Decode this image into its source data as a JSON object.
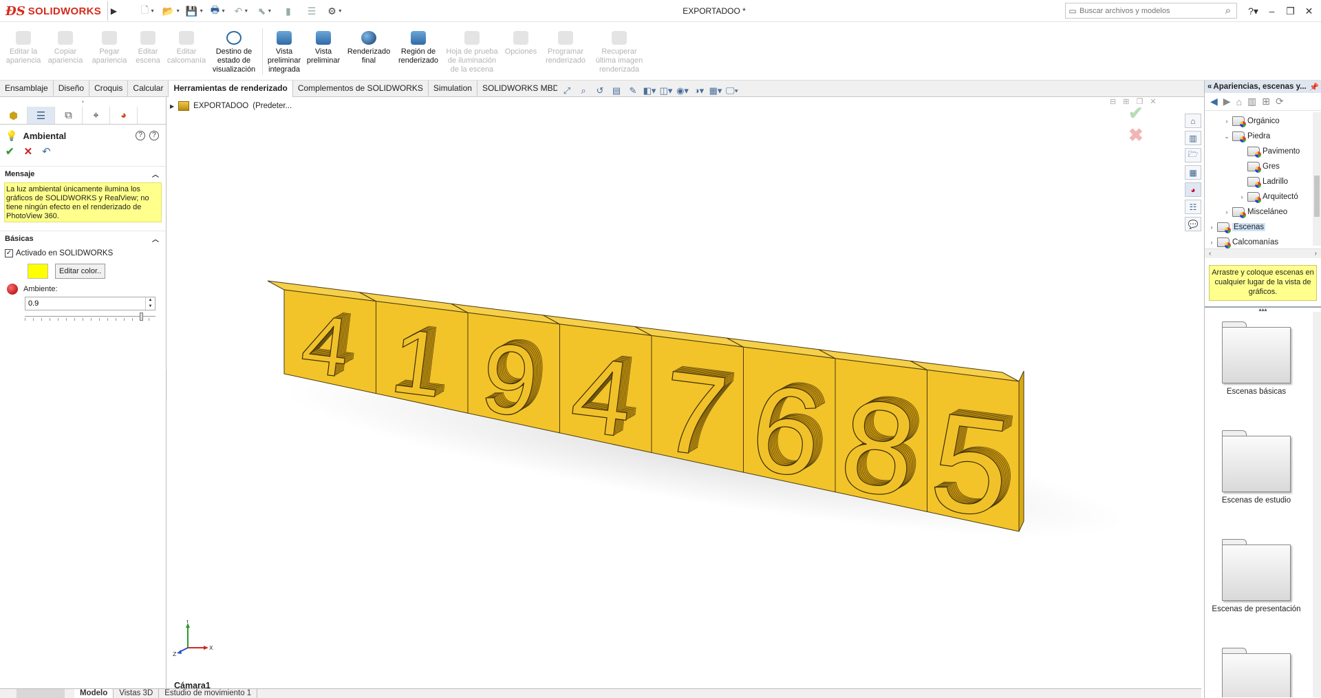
{
  "app": {
    "brand": "SOLIDWORKS",
    "document_title": "EXPORTADOO *"
  },
  "search": {
    "placeholder": "Buscar archivos y modelos"
  },
  "ribbon": {
    "buttons": [
      {
        "label": "Editar la apariencia",
        "enabled": false
      },
      {
        "label": "Copiar apariencia",
        "enabled": false
      },
      {
        "label": "Pegar apariencia",
        "enabled": false
      },
      {
        "label": "Editar escena",
        "enabled": false
      },
      {
        "label": "Editar calcomanía",
        "enabled": false
      },
      {
        "label": "Destino de estado de visualización",
        "enabled": true
      },
      {
        "label": "Vista preliminar integrada",
        "enabled": true
      },
      {
        "label": "Vista preliminar",
        "enabled": true
      },
      {
        "label": "Renderizado final",
        "enabled": true
      },
      {
        "label": "Región de renderizado",
        "enabled": true
      },
      {
        "label": "Hoja de prueba de iluminación de la escena",
        "enabled": false
      },
      {
        "label": "Opciones",
        "enabled": false
      },
      {
        "label": "Programar renderizado",
        "enabled": false
      },
      {
        "label": "Recuperar última imagen renderizada",
        "enabled": false
      }
    ]
  },
  "command_tabs": [
    "Ensamblaje",
    "Diseño",
    "Croquis",
    "Calcular",
    "Herramientas de renderizado",
    "Complementos de SOLIDWORKS",
    "Simulation",
    "SOLIDWORKS MBD"
  ],
  "command_tabs_active": "Herramientas de renderizado",
  "property_manager": {
    "title": "Ambiental",
    "message_section": "Mensaje",
    "message": "La luz ambiental únicamente ilumina los gráficos de SOLIDWORKS y RealView; no tiene ningún efecto en el renderizado de PhotoView 360.",
    "basic_section": "Básicas",
    "enabled_label": "Activado en SOLIDWORKS",
    "enabled_checked": true,
    "edit_color_label": "Editar color..",
    "ambient_color": "#ffff00",
    "ambient_label": "Ambiente:",
    "ambient_value": "0.9",
    "ambient_fraction": 0.9
  },
  "feature_tree": {
    "root_label": "EXPORTADOO",
    "root_config": "(Predeter..."
  },
  "model": {
    "digits": [
      "4",
      "1",
      "9",
      "4",
      "7",
      "6",
      "8",
      "5"
    ],
    "color": "#f2c42a"
  },
  "viewport": {
    "camera_label": "Cámara1"
  },
  "bottom_tabs": [
    "Modelo",
    "Vistas 3D",
    "Estudio de movimiento 1"
  ],
  "bottom_tabs_active": "Modelo",
  "task_pane": {
    "header": "Apariencias, escenas y...",
    "tree": [
      {
        "label": "Orgánico",
        "level": 1,
        "expanded": false
      },
      {
        "label": "Piedra",
        "level": 1,
        "expanded": true
      },
      {
        "label": "Pavimento",
        "level": 2,
        "expanded": null
      },
      {
        "label": "Gres",
        "level": 2,
        "expanded": null
      },
      {
        "label": "Ladrillo",
        "level": 2,
        "expanded": null
      },
      {
        "label": "Arquitectó",
        "level": 2,
        "expanded": false
      },
      {
        "label": "Misceláneo",
        "level": 1,
        "expanded": false
      },
      {
        "label": "Escenas",
        "level": 0,
        "expanded": false,
        "selected": true
      },
      {
        "label": "Calcomanías",
        "level": 0,
        "expanded": false
      }
    ],
    "hint": "Arrastre y coloque escenas en cualquier lugar de la vista de gráficos.",
    "gallery": [
      "Escenas básicas",
      "Escenas de estudio",
      "Escenas de presentación",
      ""
    ]
  }
}
